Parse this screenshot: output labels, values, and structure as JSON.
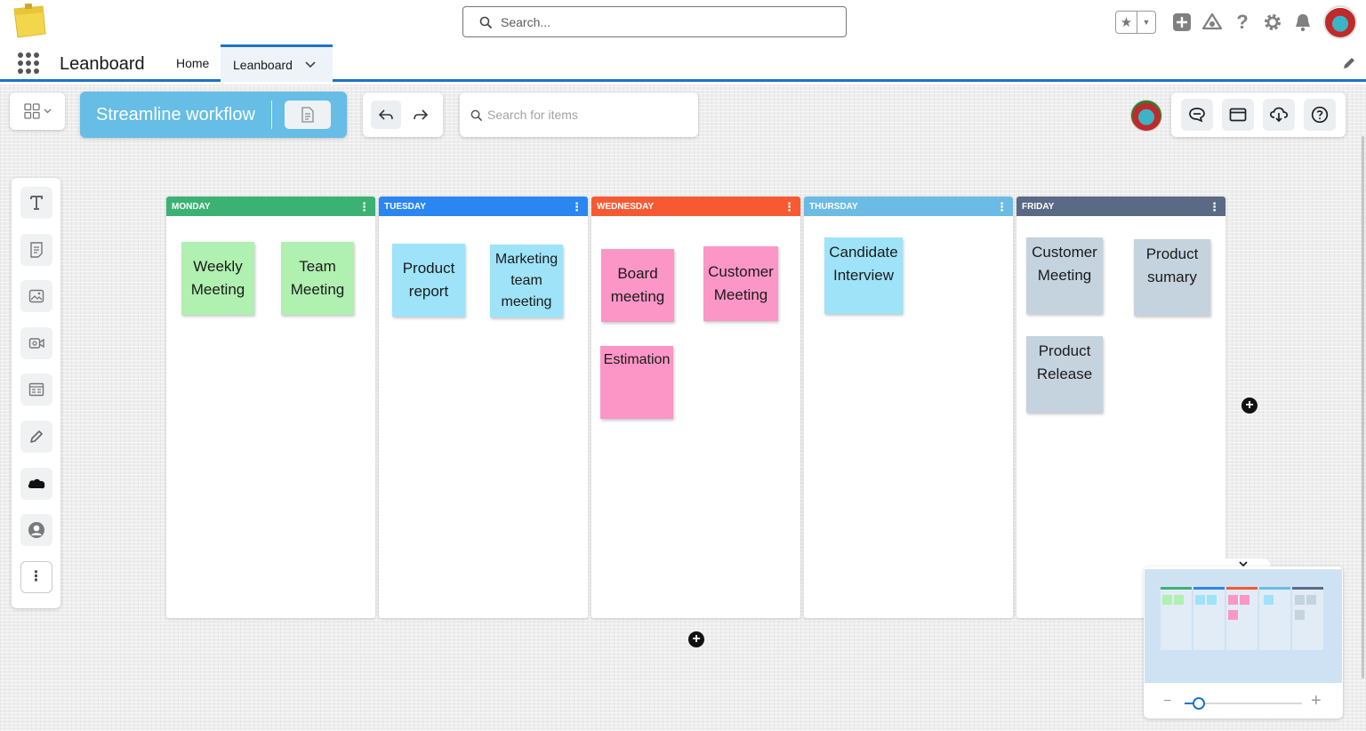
{
  "header": {
    "search_placeholder": "Search...",
    "icons": [
      "favorites-star-icon",
      "favorites-dropdown-icon",
      "add-icon",
      "trailhead-icon",
      "help-icon",
      "setup-gear-icon",
      "notifications-bell-icon",
      "user-avatar"
    ]
  },
  "nav": {
    "app_name": "Leanboard",
    "tabs": [
      {
        "label": "Home",
        "active": false
      },
      {
        "label": "Leanboard",
        "active": true
      }
    ]
  },
  "toolbar": {
    "board_title": "Streamline workflow",
    "items_search_placeholder": "Search for items",
    "right_icons": [
      "chat-icon",
      "window-icon",
      "cloud-download-icon",
      "help-icon"
    ],
    "left_tools": [
      "text-tool-icon",
      "sticky-note-icon",
      "image-icon",
      "video-icon",
      "template-icon",
      "pen-icon",
      "salesforce-cloud-icon",
      "user-icon",
      "more-icon"
    ]
  },
  "colors": {
    "monday": "#3bb273",
    "tuesday": "#2a86f1",
    "wednesday": "#f75a32",
    "thursday": "#6bbbe4",
    "friday": "#5a6a84",
    "note_green": "#b0f0b0",
    "note_blue": "#9ee3f8",
    "note_pink": "#fb96c6",
    "note_gray": "#c5d3de",
    "accent": "#1b74c9"
  },
  "board": {
    "columns": [
      {
        "title": "MONDAY",
        "notes": [
          "Weekly Meeting",
          "Team Meeting"
        ]
      },
      {
        "title": "TUESDAY",
        "notes": [
          "Product report",
          "Marketing team meeting"
        ]
      },
      {
        "title": "WEDNESDAY",
        "notes": [
          "Board meeting",
          "Customer Meeting",
          "Estimation"
        ]
      },
      {
        "title": "THURSDAY",
        "notes": [
          "Candidate Interview"
        ]
      },
      {
        "title": "FRIDAY",
        "notes": [
          "Customer Meeting",
          "Product sumary",
          "Product Release"
        ]
      }
    ]
  },
  "minimap": {
    "zoom_minus": "−",
    "zoom_plus": "+",
    "zoom_level_fraction": 0.12
  }
}
